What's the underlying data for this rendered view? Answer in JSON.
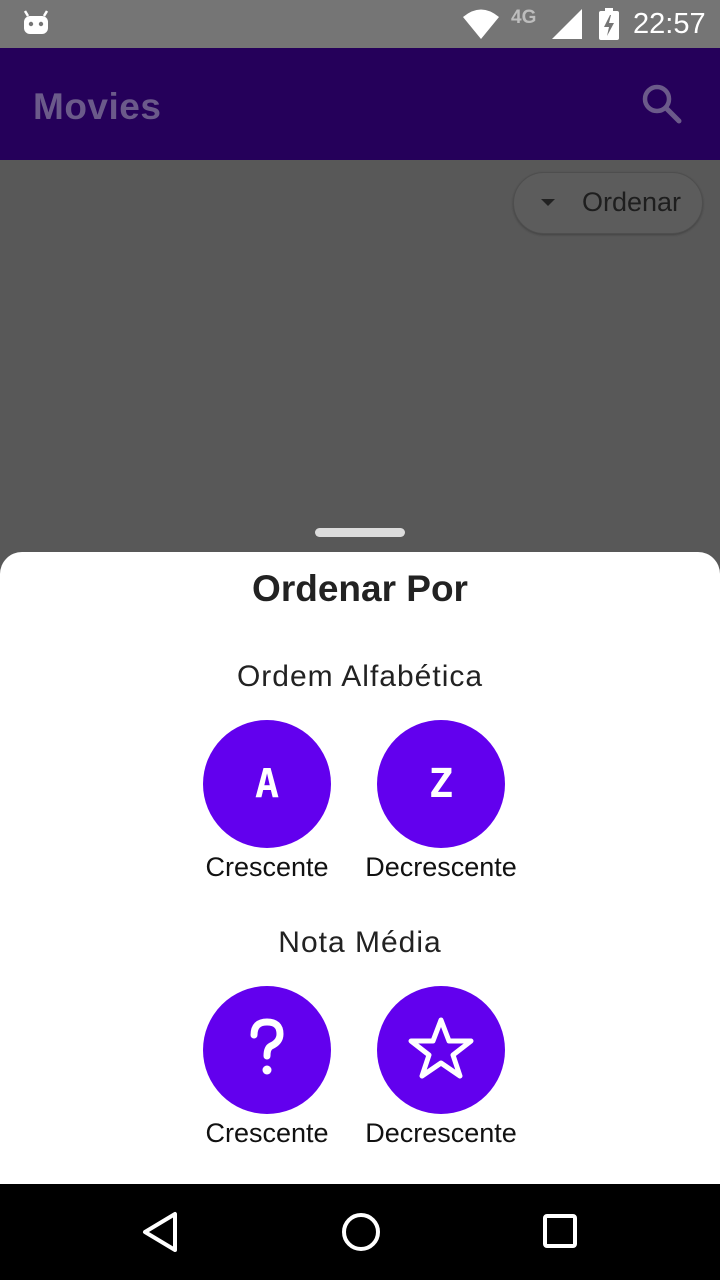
{
  "status_bar": {
    "network": "4G",
    "time": "22:57"
  },
  "app_bar": {
    "title": "Movies",
    "search_icon": "search-icon"
  },
  "main": {
    "sort_chip_label": "Ordenar"
  },
  "sheet": {
    "title": "Ordenar Por",
    "sections": [
      {
        "title": "Ordem Alfabética",
        "options": [
          {
            "icon_text": "A",
            "label": "Crescente"
          },
          {
            "icon_text": "Z",
            "label": "Decrescente"
          }
        ]
      },
      {
        "title": "Nota Média",
        "options": [
          {
            "icon": "question-mark-icon",
            "label": "Crescente"
          },
          {
            "icon": "star-outline-icon",
            "label": "Decrescente"
          }
        ]
      }
    ]
  },
  "colors": {
    "accent": "#6200ee",
    "app_bar": "#25005a",
    "scrim": "#585858"
  }
}
